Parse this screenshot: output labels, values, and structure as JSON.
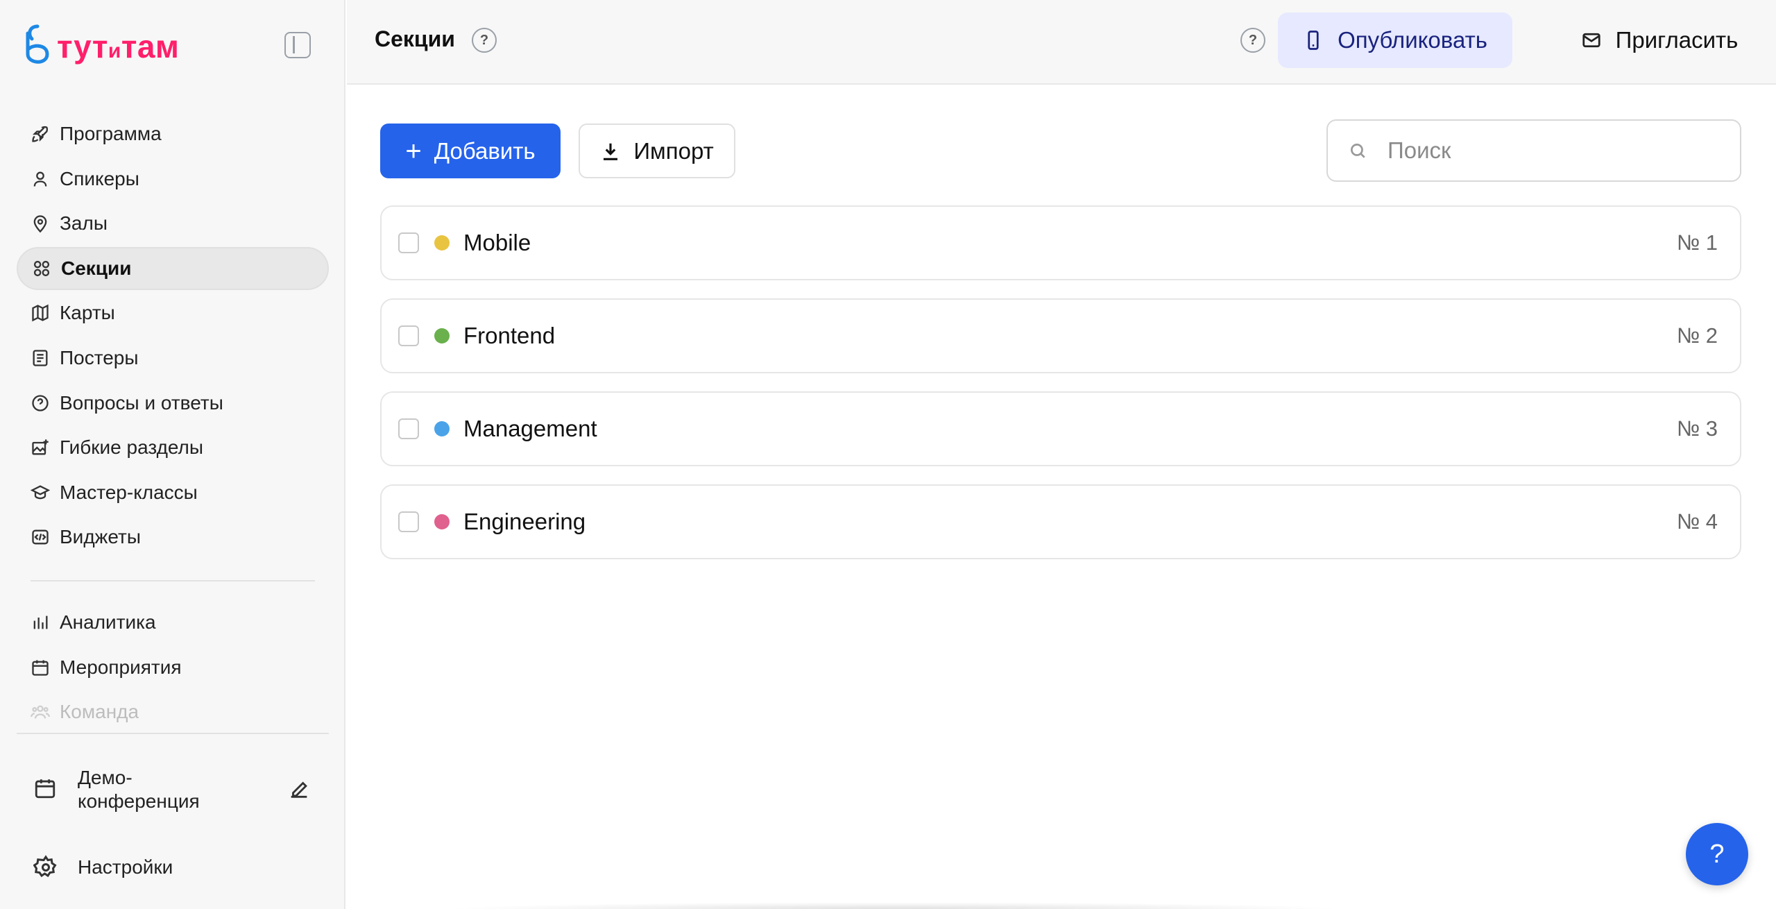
{
  "brand": {
    "logo_text": "тутитам",
    "logo_part1": "тут",
    "logo_part2": "и",
    "logo_part3": "там",
    "logo_color": "#ff1f6b",
    "logo_mark_color": "#1e88e5"
  },
  "sidebar": {
    "items": [
      {
        "label": "Программа",
        "icon": "rocket-icon"
      },
      {
        "label": "Спикеры",
        "icon": "user-icon"
      },
      {
        "label": "Залы",
        "icon": "map-pin-icon"
      },
      {
        "label": "Секции",
        "icon": "grid-icon",
        "active": true
      },
      {
        "label": "Карты",
        "icon": "map-icon"
      },
      {
        "label": "Постеры",
        "icon": "poster-icon"
      },
      {
        "label": "Вопросы и ответы",
        "icon": "help-circle-icon"
      },
      {
        "label": "Гибкие разделы",
        "icon": "image-plus-icon"
      },
      {
        "label": "Мастер-классы",
        "icon": "graduation-cap-icon"
      },
      {
        "label": "Виджеты",
        "icon": "code-icon"
      }
    ],
    "items2": [
      {
        "label": "Аналитика",
        "icon": "bar-chart-icon"
      },
      {
        "label": "Мероприятия",
        "icon": "calendar-icon"
      },
      {
        "label": "Команда",
        "icon": "team-icon"
      }
    ],
    "conference": {
      "name": "Демо-конференция",
      "line1": "Демо-",
      "line2": "конференция"
    },
    "settings_label": "Настройки"
  },
  "header": {
    "title": "Секции",
    "help_label": "?",
    "publish_label": "Опубликовать",
    "invite_label": "Пригласить"
  },
  "toolbar": {
    "add_label": "Добавить",
    "add_plus": "+",
    "import_label": "Импорт",
    "search_placeholder": "Поиск"
  },
  "sections": [
    {
      "name": "Mobile",
      "number": "№ 1",
      "color": "#e8c441"
    },
    {
      "name": "Frontend",
      "number": "№ 2",
      "color": "#6ab04c"
    },
    {
      "name": "Management",
      "number": "№ 3",
      "color": "#4aa3e8"
    },
    {
      "name": "Engineering",
      "number": "№ 4",
      "color": "#e0608e"
    }
  ],
  "fab_label": "?",
  "colors": {
    "accent": "#2563eb",
    "publish_bg": "#e6e9ff",
    "publish_text": "#1a237e"
  }
}
